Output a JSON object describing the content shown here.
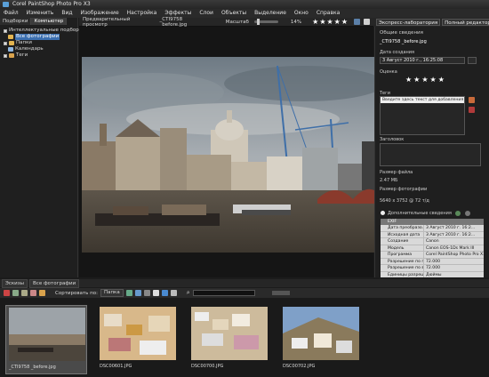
{
  "window": {
    "title": "Corel PaintShop Photo Pro X3"
  },
  "menu": [
    "Файл",
    "Изменить",
    "Вид",
    "Изображение",
    "Настройка",
    "Эффекты",
    "Слои",
    "Объекты",
    "Выделение",
    "Окно",
    "Справка"
  ],
  "left_panel": {
    "tabs": [
      "Подборки",
      "Компьютер"
    ],
    "tree": [
      {
        "label": "Интеллектуальные подборки"
      },
      {
        "label": "Все фотографии",
        "selected": true
      },
      {
        "label": "Папки"
      },
      {
        "label": "Календарь"
      },
      {
        "label": "Теги"
      }
    ]
  },
  "center_toolbar": {
    "preview_label": "Предварительный просмотр",
    "filename": "_CTI9758 _before.jpg",
    "zoom_label": "Масштаб",
    "zoom_value": "14%",
    "zoom_fraction": 0.14,
    "rating": "★★★★★"
  },
  "right_panel": {
    "buttons": [
      "Экспресс-лаборатория",
      "Полный редактор"
    ],
    "general_info": "Общие сведения",
    "filename": "_CTI9758 _before.jpg",
    "date_label": "Дата создания",
    "date_value": "3 Август 2010 г., 16:25:08",
    "rating_label": "Оценка",
    "rating": "★★★★★",
    "tags_label": "Теги",
    "tags_placeholder": "Введите здесь текст для добавления тега",
    "caption_label": "Заголовок",
    "filesize_label": "Размер файла",
    "filesize_value": "2.47 МБ",
    "photosize_label": "Размер фотографии",
    "photosize_value": "5640 x 3752 @ 72 т/д",
    "extra_label": "Дополнительные сведения",
    "exif": {
      "header": "EXIF",
      "rows": [
        {
          "k": "Дата преобразо...",
          "v": "3 Август 2010 г. 16:2..."
        },
        {
          "k": "Исходная дата",
          "v": "3 Август 2010 г. 16:2..."
        },
        {
          "k": "Создание",
          "v": "Canon"
        },
        {
          "k": "Модель",
          "v": "Canon EOS-1Ds Mark III"
        },
        {
          "k": "Программа",
          "v": "Corel PaintShop Photo Pro X3"
        },
        {
          "k": "Разрешение по г...",
          "v": "72.000"
        },
        {
          "k": "Разрешение по в...",
          "v": "72.000"
        },
        {
          "k": "Единицы разреш...",
          "v": "Дюймы"
        }
      ]
    }
  },
  "bottom": {
    "tabs": [
      "Эскизы",
      "Все фотографии"
    ],
    "sort_label": "Сортировать по:",
    "sort_value": "Папка",
    "thumbnails": [
      {
        "caption": "_CTI9758 _before.jpg",
        "selected": true
      },
      {
        "caption": "DSC00601.JPG"
      },
      {
        "caption": "DSC00700.JPG"
      },
      {
        "caption": "DSC00702.JPG"
      }
    ]
  },
  "colors": {
    "accent": "#3b6fb0",
    "bg": "#1b1b1b",
    "panel": "#1f1f1f"
  }
}
